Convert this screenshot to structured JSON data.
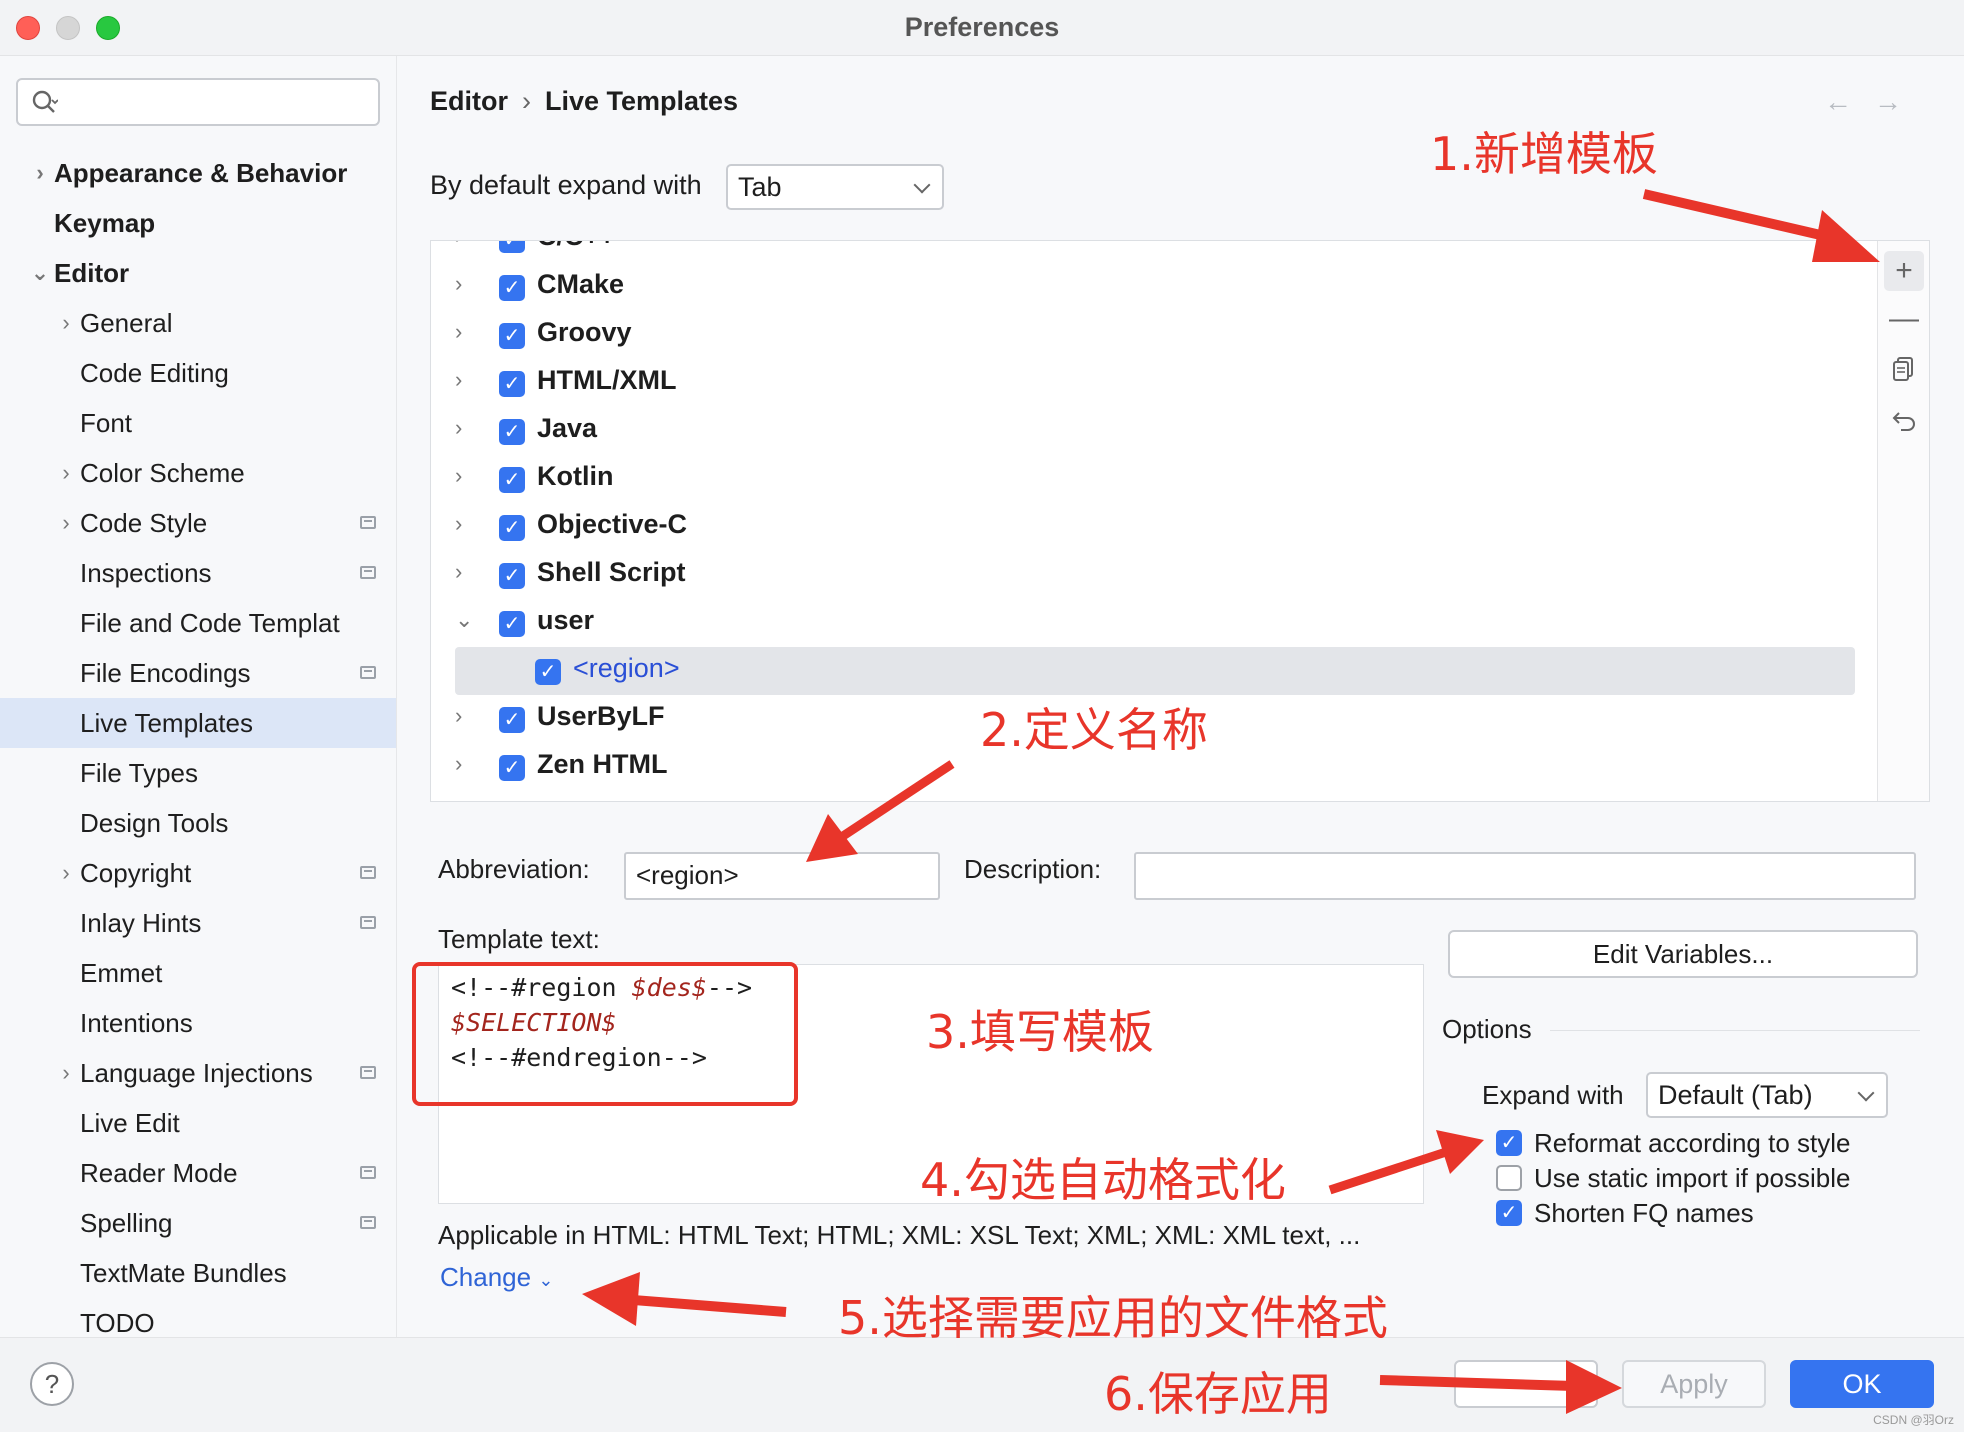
{
  "window": {
    "title": "Preferences"
  },
  "search": {
    "placeholder": ""
  },
  "sidebar": {
    "items": [
      {
        "label": "Appearance & Behavior",
        "level": 0,
        "bold": true,
        "chevron": "right"
      },
      {
        "label": "Keymap",
        "level": 0,
        "bold": true,
        "chevron": ""
      },
      {
        "label": "Editor",
        "level": 0,
        "bold": true,
        "chevron": "down"
      },
      {
        "label": "General",
        "level": 1,
        "chevron": "right"
      },
      {
        "label": "Code Editing",
        "level": 1,
        "chevron": ""
      },
      {
        "label": "Font",
        "level": 1,
        "chevron": ""
      },
      {
        "label": "Color Scheme",
        "level": 1,
        "chevron": "right"
      },
      {
        "label": "Code Style",
        "level": 1,
        "chevron": "right",
        "project": true
      },
      {
        "label": "Inspections",
        "level": 1,
        "chevron": "",
        "project": true
      },
      {
        "label": "File and Code Templat",
        "level": 1,
        "chevron": ""
      },
      {
        "label": "File Encodings",
        "level": 1,
        "chevron": "",
        "project": true
      },
      {
        "label": "Live Templates",
        "level": 1,
        "chevron": "",
        "selected": true
      },
      {
        "label": "File Types",
        "level": 1,
        "chevron": ""
      },
      {
        "label": "Design Tools",
        "level": 1,
        "chevron": ""
      },
      {
        "label": "Copyright",
        "level": 1,
        "chevron": "right",
        "project": true
      },
      {
        "label": "Inlay Hints",
        "level": 1,
        "chevron": "",
        "project": true
      },
      {
        "label": "Emmet",
        "level": 1,
        "chevron": ""
      },
      {
        "label": "Intentions",
        "level": 1,
        "chevron": ""
      },
      {
        "label": "Language Injections",
        "level": 1,
        "chevron": "right",
        "project": true
      },
      {
        "label": "Live Edit",
        "level": 1,
        "chevron": ""
      },
      {
        "label": "Reader Mode",
        "level": 1,
        "chevron": "",
        "project": true
      },
      {
        "label": "Spelling",
        "level": 1,
        "chevron": "",
        "project": true
      },
      {
        "label": "TextMate Bundles",
        "level": 1,
        "chevron": ""
      },
      {
        "label": "TODO",
        "level": 1,
        "chevron": ""
      }
    ]
  },
  "breadcrumb": {
    "parent": "Editor",
    "separator": "›",
    "current": "Live Templates"
  },
  "nav": {
    "back": "←",
    "forward": "→"
  },
  "expand_default": {
    "label": "By default expand with",
    "value": "Tab"
  },
  "template_groups": [
    {
      "name": "C/C++",
      "expanded": false,
      "checked": true
    },
    {
      "name": "CMake",
      "expanded": false,
      "checked": true
    },
    {
      "name": "Groovy",
      "expanded": false,
      "checked": true
    },
    {
      "name": "HTML/XML",
      "expanded": false,
      "checked": true
    },
    {
      "name": "Java",
      "expanded": false,
      "checked": true
    },
    {
      "name": "Kotlin",
      "expanded": false,
      "checked": true
    },
    {
      "name": "Objective-C",
      "expanded": false,
      "checked": true
    },
    {
      "name": "Shell Script",
      "expanded": false,
      "checked": true
    },
    {
      "name": "user",
      "expanded": true,
      "checked": true,
      "children": [
        {
          "name": "<region>",
          "checked": true
        }
      ]
    },
    {
      "name": "UserByLF",
      "expanded": false,
      "checked": true
    },
    {
      "name": "Zen HTML",
      "expanded": false,
      "checked": true
    }
  ],
  "toolbar": {
    "add": "+",
    "remove": "—",
    "copy": "copy",
    "restore": "undo"
  },
  "abbreviation": {
    "label": "Abbreviation:",
    "value": "<region>"
  },
  "description": {
    "label": "Description:",
    "value": ""
  },
  "template_text": {
    "label": "Template text:",
    "lines": [
      {
        "before": "<!--#region ",
        "var": "$des$",
        "after": "-->"
      },
      {
        "before": "",
        "var": "$SELECTION$",
        "after": ""
      },
      {
        "before": "<!--#endregion-->",
        "var": "",
        "after": ""
      }
    ]
  },
  "edit_variables": {
    "label": "Edit Variables..."
  },
  "options": {
    "title": "Options",
    "expand_with_label": "Expand with",
    "expand_with_value": "Default (Tab)",
    "checkboxes": [
      {
        "label": "Reformat according to style",
        "checked": true
      },
      {
        "label": "Use static import if possible",
        "checked": false
      },
      {
        "label": "Shorten FQ names",
        "checked": true
      }
    ]
  },
  "applicable": {
    "text": "Applicable in HTML: HTML Text; HTML; XML: XSL Text; XML; XML: XML text, ...",
    "change_label": "Change"
  },
  "footer": {
    "help": "?",
    "cancel": "",
    "apply": "Apply",
    "ok": "OK"
  },
  "annotations": {
    "a1": "1.新增模板",
    "a2": "2.定义名称",
    "a3": "3.填写模板",
    "a4": "4.勾选自动格式化",
    "a5": "5.选择需要应用的文件格式",
    "a6": "6.保存应用"
  },
  "watermark": "CSDN @羽Orz",
  "colors": {
    "accent": "#3574f0",
    "annotation": "#e8352a",
    "selection": "#dce6f7"
  }
}
